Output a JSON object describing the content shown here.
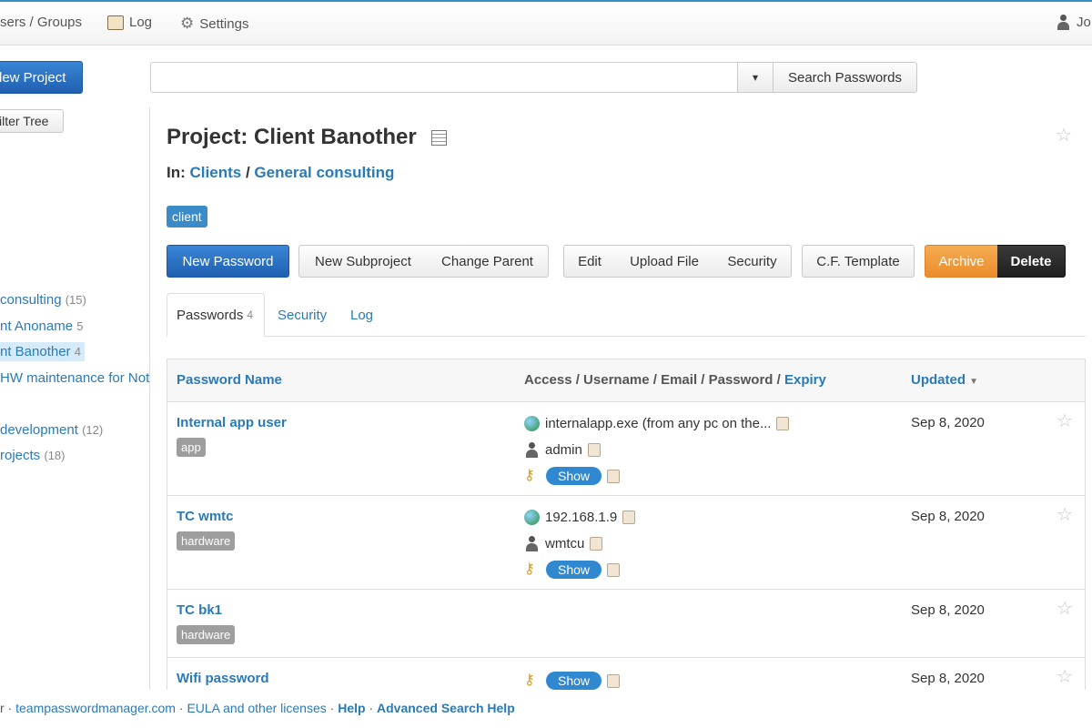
{
  "topnav": {
    "users_groups": "sers / Groups",
    "log": "Log",
    "settings": "Settings",
    "user": "Jo"
  },
  "toolbar": {
    "new_project": "lew Project",
    "search_placeholder": "",
    "search_button": "Search Passwords",
    "dropdown_caret": "▾"
  },
  "sidebar": {
    "filter_tree": "ilter Tree",
    "items": [
      {
        "label": " consulting",
        "count": "(15)"
      },
      {
        "label": "nt Anoname",
        "count": "5"
      },
      {
        "label": "nt Banother",
        "count": "4"
      },
      {
        "label": "HW maintenance for Not",
        "count": ""
      },
      {
        "label": " development",
        "count": "(12)"
      },
      {
        "label": "rojects",
        "count": "(18)"
      }
    ]
  },
  "project": {
    "title": "Project: Client Banother",
    "in_label": "In:",
    "parent1": "Clients",
    "separator": "/",
    "parent2": "General consulting",
    "tag": "client"
  },
  "actions": {
    "new_password": "New Password",
    "new_subproject": "New Subproject",
    "change_parent": "Change Parent",
    "edit": "Edit",
    "upload_file": "Upload File",
    "security": "Security",
    "cf_template": "C.F. Template",
    "archive": "Archive",
    "delete": "Delete"
  },
  "tabs": {
    "passwords": "Passwords",
    "passwords_count": "4",
    "security": "Security",
    "log": "Log"
  },
  "table": {
    "col_name": "Password Name",
    "col_access": "Access / Username / Email / Password /",
    "col_expiry": "Expiry",
    "col_updated": "Updated",
    "show_label": "Show",
    "rows": [
      {
        "name": "Internal app user",
        "tag": "app",
        "access": "internalapp.exe (from any pc on the...",
        "username": "admin",
        "updated": "Sep 8, 2020"
      },
      {
        "name": "TC wmtc",
        "tag": "hardware",
        "access": "192.168.1.9",
        "username": "wmtcu",
        "updated": "Sep 8, 2020"
      },
      {
        "name": "TC bk1",
        "tag": "hardware",
        "updated": "Sep 8, 2020"
      },
      {
        "name": "Wifi password",
        "updated": "Sep 8, 2020"
      }
    ]
  },
  "footer": {
    "prefix": "r ·",
    "site": "teampasswordmanager.com",
    "sep": "·",
    "eula": "EULA and other licenses",
    "help": "Help",
    "adv_help": "Advanced Search Help"
  },
  "icons": {
    "star": "☆",
    "key": "⚷"
  }
}
